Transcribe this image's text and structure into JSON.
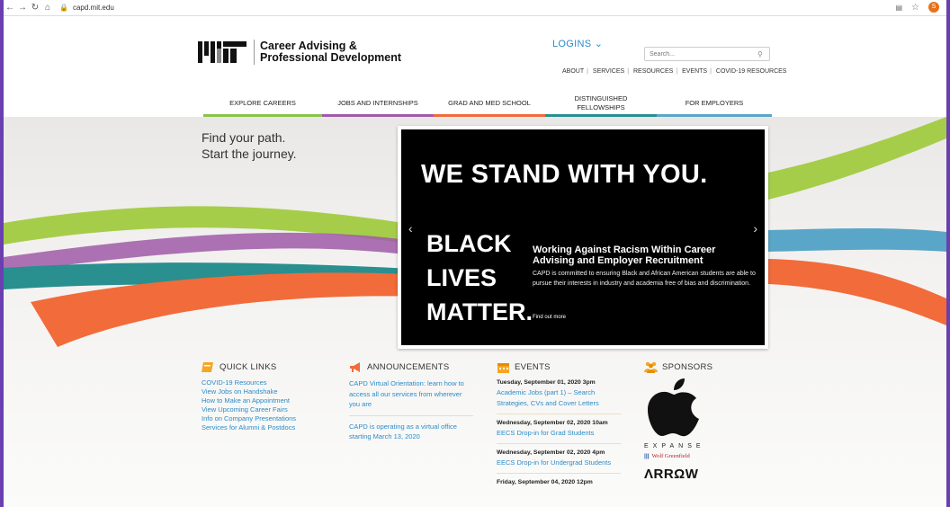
{
  "browser": {
    "url": "capd.mit.edu",
    "avatar_initial": "S"
  },
  "header": {
    "logo_line1": "Career Advising &",
    "logo_line2": "Professional Development",
    "logins_label": "LOGINS ⌄",
    "search_placeholder": "Search...",
    "top_links": [
      "ABOUT",
      "SERVICES",
      "RESOURCES",
      "EVENTS",
      "COVID-19 RESOURCES"
    ]
  },
  "nav": {
    "tabs": [
      {
        "label": "EXPLORE CAREERS",
        "color": "#8bc34a"
      },
      {
        "label": "JOBS AND INTERNSHIPS",
        "color": "#a05aa8"
      },
      {
        "label": "GRAD AND MED SCHOOL",
        "color": "#f26b3a"
      },
      {
        "label": "DISTINGUISHED FELLOWSHIPS",
        "color": "#2a8f8f"
      },
      {
        "label": "FOR EMPLOYERS",
        "color": "#5aa6c8"
      }
    ]
  },
  "hero": {
    "tagline_line1": "Find your path.",
    "tagline_line2": "Start the journey.",
    "slide": {
      "headline": "WE STAND WITH YOU.",
      "blm_line1": "BLACK",
      "blm_line2": "LIVES",
      "blm_line3": "MATTER.",
      "title": "Working Against Racism Within Career Advising and Employer Recruitment",
      "description": "CAPD is committed to ensuring Black and African American students are able to pursue their interests in industry and academia free of bias and discrimination.",
      "more_label": "Find out more"
    }
  },
  "quick_links": {
    "heading": "QUICK LINKS",
    "items": [
      "COVID-19 Resources",
      "View Jobs on Handshake",
      "How to Make an Appointment",
      "View Upcoming Career Fairs",
      "Info on Company Presentations",
      "Services for Alumni & Postdocs"
    ]
  },
  "announcements": {
    "heading": "ANNOUNCEMENTS",
    "items": [
      "CAPD Virtual Orientation: learn how to access all our services from wherever you are",
      "CAPD is operating as a virtual office starting March 13, 2020"
    ]
  },
  "events": {
    "heading": "EVENTS",
    "items": [
      {
        "date": "Tuesday, September 01, 2020 3pm",
        "title": "Academic Jobs (part 1) – Search Strategies, CVs and Cover Letters"
      },
      {
        "date": "Wednesday, September 02, 2020 10am",
        "title": "EECS Drop-in for Grad Students"
      },
      {
        "date": "Wednesday, September 02, 2020 4pm",
        "title": "EECS Drop-in for Undergrad Students"
      },
      {
        "date": "Friday, September 04, 2020 12pm",
        "title": ""
      }
    ]
  },
  "sponsors": {
    "heading": "SPONSORS",
    "expanse": "EXPANSE",
    "wolf": "Wolf Greenfield",
    "arrow": "ΛRRΩW"
  }
}
